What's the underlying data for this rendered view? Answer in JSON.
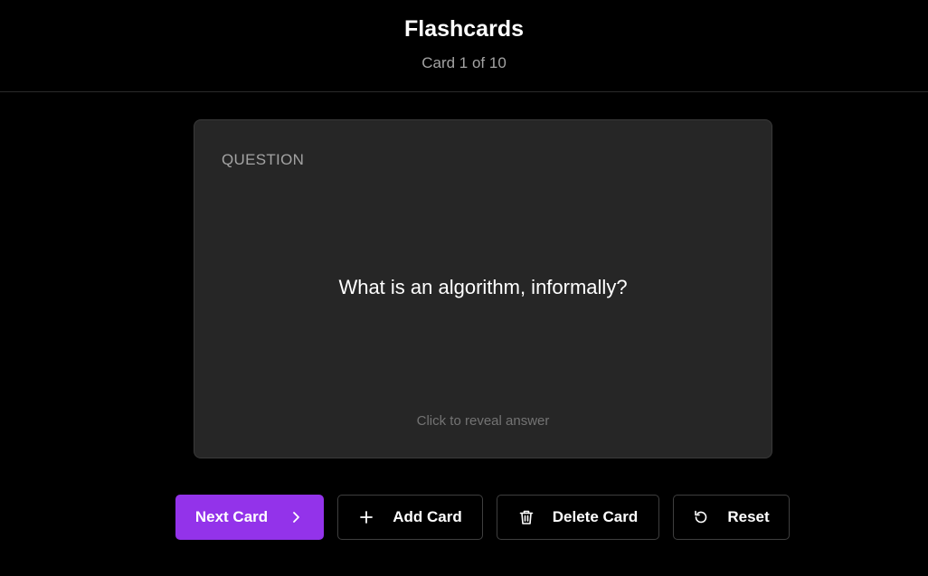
{
  "header": {
    "title": "Flashcards",
    "counter": "Card 1 of 10"
  },
  "card": {
    "side_label": "QUESTION",
    "question": "What is an algorithm, informally?",
    "hint": "Click to reveal answer"
  },
  "actions": {
    "next_label": "Next Card",
    "add_label": "Add Card",
    "delete_label": "Delete Card",
    "reset_label": "Reset"
  },
  "icons": {
    "next": "chevron-right-icon",
    "add": "plus-icon",
    "delete": "trash-icon",
    "reset": "rotate-ccw-icon"
  },
  "colors": {
    "background": "#000000",
    "card": "#262626",
    "accent": "#9333ea",
    "muted_text": "#a3a3a3",
    "hint_text": "#737373"
  }
}
